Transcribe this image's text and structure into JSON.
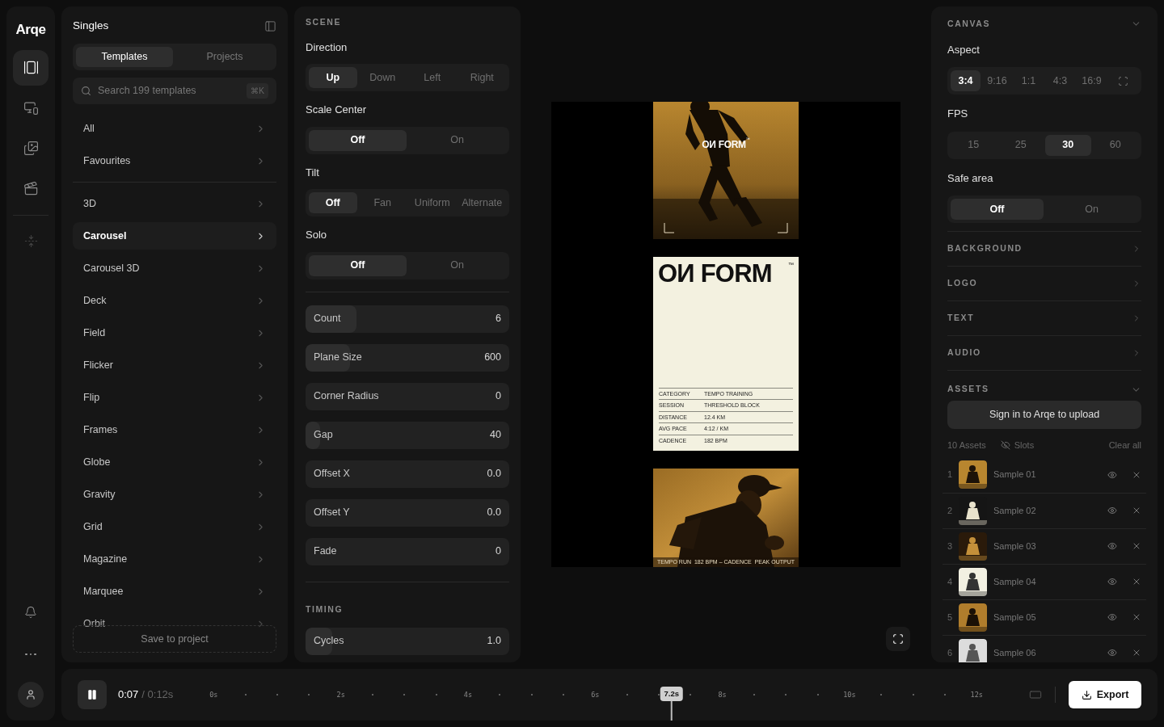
{
  "rail": {
    "logo": "Arqe",
    "nav": [
      {
        "selected": true
      },
      {
        "selected": false
      },
      {
        "selected": false
      },
      {
        "selected": false
      }
    ],
    "tools": [
      {
        "disabled": true
      }
    ]
  },
  "library": {
    "title": "Singles",
    "tabs": [
      {
        "label": "Templates",
        "selected": true
      },
      {
        "label": "Projects",
        "selected": false
      }
    ],
    "search": {
      "placeholder": "Search 199 templates",
      "shortcut": "⌘K"
    },
    "groups": [
      [
        {
          "label": "All",
          "selected": false
        },
        {
          "label": "Favourites",
          "selected": false
        }
      ],
      [
        {
          "label": "3D",
          "selected": false
        },
        {
          "label": "Carousel",
          "selected": true
        },
        {
          "label": "Carousel 3D",
          "selected": false
        },
        {
          "label": "Deck",
          "selected": false
        },
        {
          "label": "Field",
          "selected": false
        },
        {
          "label": "Flicker",
          "selected": false
        },
        {
          "label": "Flip",
          "selected": false
        },
        {
          "label": "Frames",
          "selected": false
        },
        {
          "label": "Globe",
          "selected": false
        },
        {
          "label": "Gravity",
          "selected": false
        },
        {
          "label": "Grid",
          "selected": false
        },
        {
          "label": "Magazine",
          "selected": false
        },
        {
          "label": "Marquee",
          "selected": false
        },
        {
          "label": "Orbit",
          "selected": false
        }
      ]
    ],
    "save": "Save to project"
  },
  "scene": {
    "title": "SCENE",
    "options": [
      {
        "label": "Direction",
        "choices": [
          {
            "label": "Up",
            "selected": true
          },
          {
            "label": "Down",
            "selected": false
          },
          {
            "label": "Left",
            "selected": false
          },
          {
            "label": "Right",
            "selected": false
          }
        ]
      },
      {
        "label": "Scale Center",
        "choices": [
          {
            "label": "Off",
            "selected": true
          },
          {
            "label": "On",
            "selected": false
          }
        ]
      },
      {
        "label": "Tilt",
        "choices": [
          {
            "label": "Off",
            "selected": true
          },
          {
            "label": "Fan",
            "selected": false
          },
          {
            "label": "Uniform",
            "selected": false
          },
          {
            "label": "Alternate",
            "selected": false
          }
        ]
      },
      {
        "label": "Solo",
        "choices": [
          {
            "label": "Off",
            "selected": true
          },
          {
            "label": "On",
            "selected": false
          }
        ]
      }
    ],
    "sliders": [
      {
        "label": "Count",
        "value": "6",
        "level": 0.25
      },
      {
        "label": "Plane Size",
        "value": "600",
        "level": 0.22
      },
      {
        "label": "Corner Radius",
        "value": "0"
      },
      {
        "label": "Gap",
        "value": "40",
        "level": 0.07
      },
      {
        "label": "Offset X",
        "value": "0.0"
      },
      {
        "label": "Offset Y",
        "value": "0.0"
      },
      {
        "label": "Fade",
        "value": "0"
      }
    ],
    "timing": {
      "title": "TIMING",
      "sliders": [
        {
          "label": "Cycles",
          "value": "1.0",
          "level": 0.13
        }
      ]
    }
  },
  "preview": {
    "frames": [
      {
        "kind": "photo-title",
        "title": "OИ FORM",
        "mark": "™"
      },
      {
        "kind": "poster",
        "title": "OИ FORM",
        "mark": "™",
        "rows": [
          {
            "label": "CATEGORY",
            "value": "TEMPO TRAINING"
          },
          {
            "label": "SESSION",
            "value": "THRESHOLD BLOCK"
          },
          {
            "label": "DISTANCE",
            "value": "12.4 KM"
          },
          {
            "label": "AVG PACE",
            "value": "4:12 / KM"
          },
          {
            "label": "CADENCE",
            "value": "182 BPM"
          }
        ]
      },
      {
        "kind": "photo-footer",
        "footer": [
          "TEMPO RUN",
          "182 BPM – CADENCE",
          "PEAK OUTPUT"
        ]
      }
    ]
  },
  "canvas": {
    "title": "CANVAS",
    "expanded": true,
    "options": [
      {
        "label": "Aspect",
        "choices": [
          {
            "kind": "text",
            "label": "3:4",
            "selected": true
          },
          {
            "kind": "text",
            "label": "9:16",
            "selected": false
          },
          {
            "kind": "text",
            "label": "1:1",
            "selected": false
          },
          {
            "kind": "text",
            "label": "4:3",
            "selected": false
          },
          {
            "kind": "text",
            "label": "16:9",
            "selected": false
          },
          {
            "kind": "free",
            "selected": false
          }
        ]
      },
      {
        "label": "FPS",
        "choices": [
          {
            "kind": "text",
            "label": "15",
            "selected": false
          },
          {
            "kind": "text",
            "label": "25",
            "selected": false
          },
          {
            "kind": "text",
            "label": "30",
            "selected": true
          },
          {
            "kind": "text",
            "label": "60",
            "selected": false
          }
        ]
      },
      {
        "label": "Safe area",
        "choices": [
          {
            "kind": "text",
            "label": "Off",
            "selected": true
          },
          {
            "kind": "text",
            "label": "On",
            "selected": false
          }
        ]
      }
    ],
    "sections": [
      {
        "title": "BACKGROUND",
        "expanded": false
      },
      {
        "title": "LOGO",
        "expanded": false
      },
      {
        "title": "TEXT",
        "expanded": false
      },
      {
        "title": "AUDIO",
        "expanded": false
      }
    ],
    "assets": {
      "title": "ASSETS",
      "expanded": true,
      "upload": "Sign in to Arqe to upload",
      "count": "10 Assets",
      "slots": "Slots",
      "clear": "Clear all",
      "items": [
        {
          "index": "1",
          "name": "Sample 01"
        },
        {
          "index": "2",
          "name": "Sample 02"
        },
        {
          "index": "3",
          "name": "Sample 03"
        },
        {
          "index": "4",
          "name": "Sample 04"
        },
        {
          "index": "5",
          "name": "Sample 05"
        },
        {
          "index": "6",
          "name": "Sample 06"
        }
      ]
    }
  },
  "timeline": {
    "playing": true,
    "current": "0:07",
    "total": "/ 0:12s",
    "ticks": [
      "0s",
      "2s",
      "4s",
      "6s",
      "8s",
      "10s",
      "12s"
    ],
    "playhead": {
      "label": "7.2s",
      "level": 0.6
    },
    "export": "Export"
  }
}
